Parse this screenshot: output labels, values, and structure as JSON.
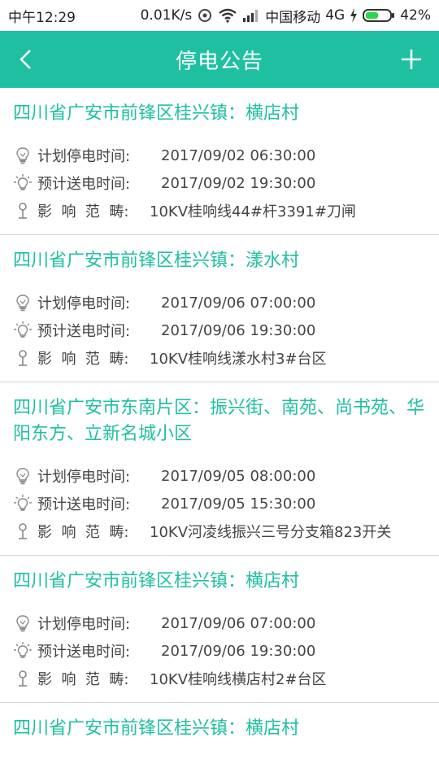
{
  "status_bar": {
    "time": "中午12:29",
    "net_speed": "0.01K/s",
    "carrier": "中国移动",
    "network": "4G",
    "battery": "42%"
  },
  "header": {
    "title": "停电公告"
  },
  "notices": [
    {
      "area": "四川省广安市前锋区桂兴镇：横店村",
      "plan_label": "计划停电时间:",
      "plan_time": "2017/09/02 06:30:00",
      "restore_label": "预计送电时间:",
      "restore_time": "2017/09/02 19:30:00",
      "range_label": "影  响  范  畴:",
      "range_value": "10KV桂响线44#杆3391#刀闸"
    },
    {
      "area": "四川省广安市前锋区桂兴镇：漾水村",
      "plan_label": "计划停电时间:",
      "plan_time": "2017/09/06 07:00:00",
      "restore_label": "预计送电时间:",
      "restore_time": "2017/09/06 19:30:00",
      "range_label": "影  响  范  畴:",
      "range_value": "10KV桂响线漾水村3#台区"
    },
    {
      "area": "四川省广安市东南片区：振兴街、南苑、尚书苑、华阳东方、立新名城小区",
      "plan_label": "计划停电时间:",
      "plan_time": "2017/09/05 08:00:00",
      "restore_label": "预计送电时间:",
      "restore_time": "2017/09/05 15:30:00",
      "range_label": "影  响  范  畴:",
      "range_value": "10KV河凌线振兴三号分支箱823开关"
    },
    {
      "area": "四川省广安市前锋区桂兴镇：横店村",
      "plan_label": "计划停电时间:",
      "plan_time": "2017/09/06 07:00:00",
      "restore_label": "预计送电时间:",
      "restore_time": "2017/09/06 19:30:00",
      "range_label": "影  响  范  畴:",
      "range_value": "10KV桂响线横店村2#台区"
    },
    {
      "area": "四川省广安市前锋区桂兴镇：横店村"
    }
  ],
  "colors": {
    "accent": "#1fc0a2",
    "text": "#444444",
    "divider": "#d6d6d6"
  }
}
